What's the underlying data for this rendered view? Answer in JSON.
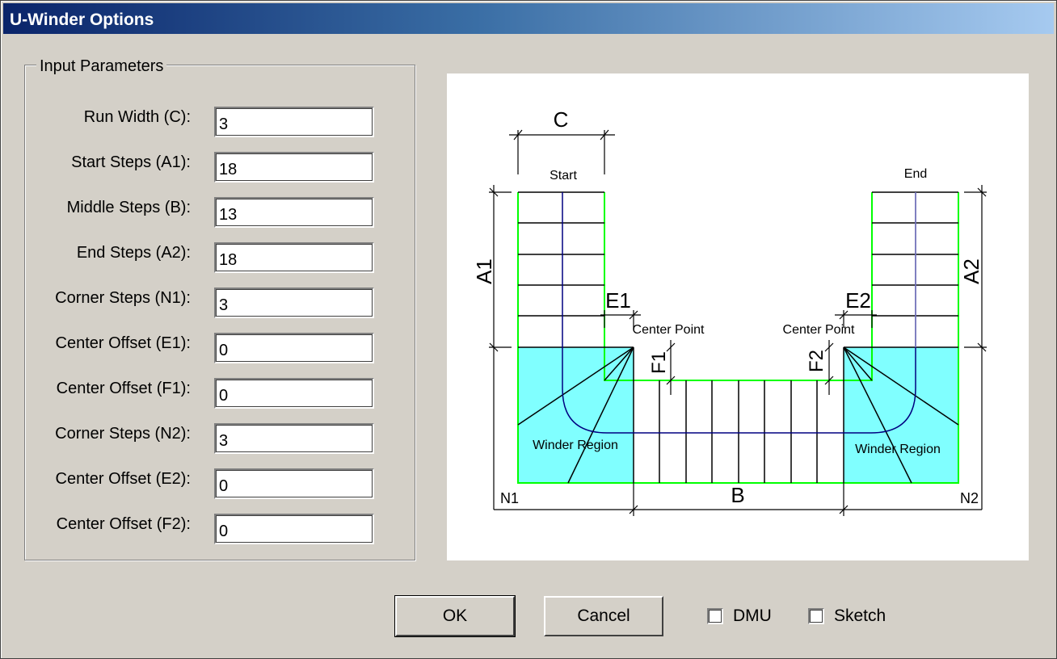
{
  "window": {
    "title": "U-Winder Options"
  },
  "input_group": {
    "legend": "Input Parameters",
    "fields": [
      {
        "label": "Run Width (C):",
        "value": "3"
      },
      {
        "label": "Start Steps (A1):",
        "value": "18"
      },
      {
        "label": "Middle Steps (B):",
        "value": "13"
      },
      {
        "label": "End Steps (A2):",
        "value": "18"
      },
      {
        "label": "Corner Steps (N1):",
        "value": "3"
      },
      {
        "label": "Center Offset (E1):",
        "value": "0"
      },
      {
        "label": "Center Offset (F1):",
        "value": "0"
      },
      {
        "label": "Corner Steps (N2):",
        "value": "3"
      },
      {
        "label": "Center Offset (E2):",
        "value": "0"
      },
      {
        "label": "Center Offset (F2):",
        "value": "0"
      }
    ]
  },
  "diagram": {
    "labels": {
      "c": "C",
      "start": "Start",
      "end": "End",
      "a1": "A1",
      "a2": "A2",
      "e1": "E1",
      "e2": "E2",
      "f1": "F1",
      "f2": "F2",
      "center_point_left": "Center Point",
      "center_point_right": "Center Point",
      "winder_left": "Winder Region",
      "winder_right": "Winder Region",
      "b": "B",
      "n1": "N1",
      "n2": "N2"
    },
    "colors": {
      "winder_fill": "#80ffff",
      "outline": "#00ff00",
      "walkline": "#000080",
      "dim": "#000000"
    }
  },
  "buttons": {
    "ok": "OK",
    "cancel": "Cancel"
  },
  "checkboxes": {
    "dmu": {
      "label": "DMU",
      "checked": false
    },
    "sketch": {
      "label": "Sketch",
      "checked": false
    }
  }
}
